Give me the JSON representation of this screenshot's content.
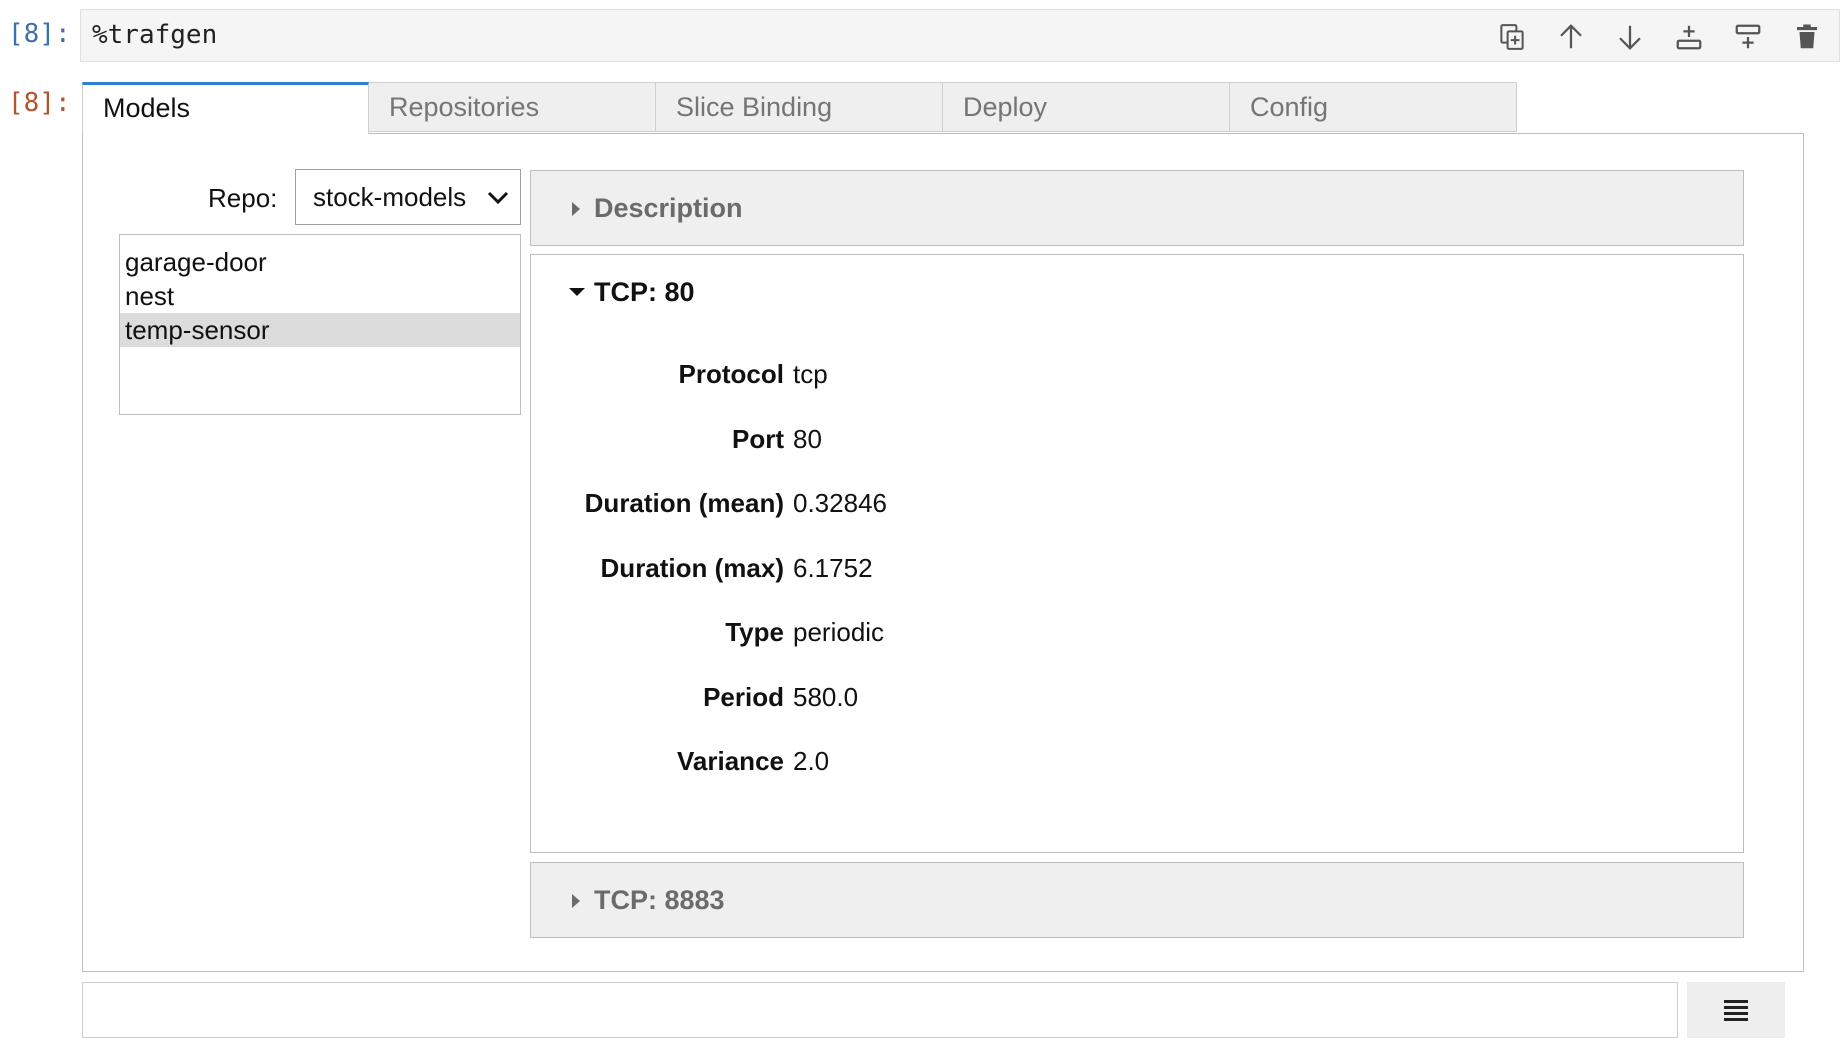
{
  "cell": {
    "input_prompt": "[8]:",
    "output_prompt": "[8]:",
    "code": "%trafgen",
    "toolbar": [
      {
        "name": "duplicate-cell-icon"
      },
      {
        "name": "move-up-icon"
      },
      {
        "name": "move-down-icon"
      },
      {
        "name": "insert-below-icon"
      },
      {
        "name": "insert-above-icon"
      },
      {
        "name": "delete-cell-icon"
      }
    ]
  },
  "tabs": [
    "Models",
    "Repositories",
    "Slice Binding",
    "Deploy",
    "Config"
  ],
  "active_tab": "Models",
  "repo": {
    "label": "Repo:",
    "selected": "stock-models"
  },
  "models": {
    "items": [
      "garage-door",
      "nest",
      "temp-sensor"
    ],
    "selected": "temp-sensor"
  },
  "accordion": {
    "description": {
      "title": "Description",
      "expanded": false
    },
    "tcp80": {
      "title": "TCP: 80",
      "expanded": true,
      "fields": [
        {
          "key": "Protocol",
          "value": "tcp"
        },
        {
          "key": "Port",
          "value": "80"
        },
        {
          "key": "Duration (mean)",
          "value": "0.32846"
        },
        {
          "key": "Duration (max)",
          "value": "6.1752"
        },
        {
          "key": "Type",
          "value": "periodic"
        },
        {
          "key": "Period",
          "value": "580.0"
        },
        {
          "key": "Variance",
          "value": "2.0"
        }
      ]
    },
    "tcp8883": {
      "title": "TCP: 8883",
      "expanded": false
    }
  },
  "colors": {
    "input_prompt": "#3f6fad",
    "output_prompt": "#b0552f",
    "active_tab_accent": "#2f7fd4"
  }
}
